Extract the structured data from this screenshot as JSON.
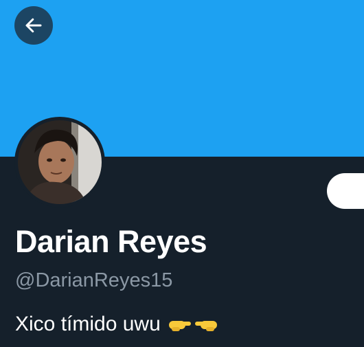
{
  "colors": {
    "banner": "#1da1f2",
    "background": "#15202b",
    "back_button_bg": "#1c4563",
    "handle_text": "#8b98a5",
    "emoji": "#f8c93a"
  },
  "header": {
    "back_icon": "arrow-left-icon"
  },
  "profile": {
    "display_name": "Darian Reyes",
    "handle": "@DarianReyes15",
    "bio_text": "Xico tímido uwu",
    "bio_emoji": [
      "backhand-index-pointing-right",
      "backhand-index-pointing-left"
    ]
  }
}
